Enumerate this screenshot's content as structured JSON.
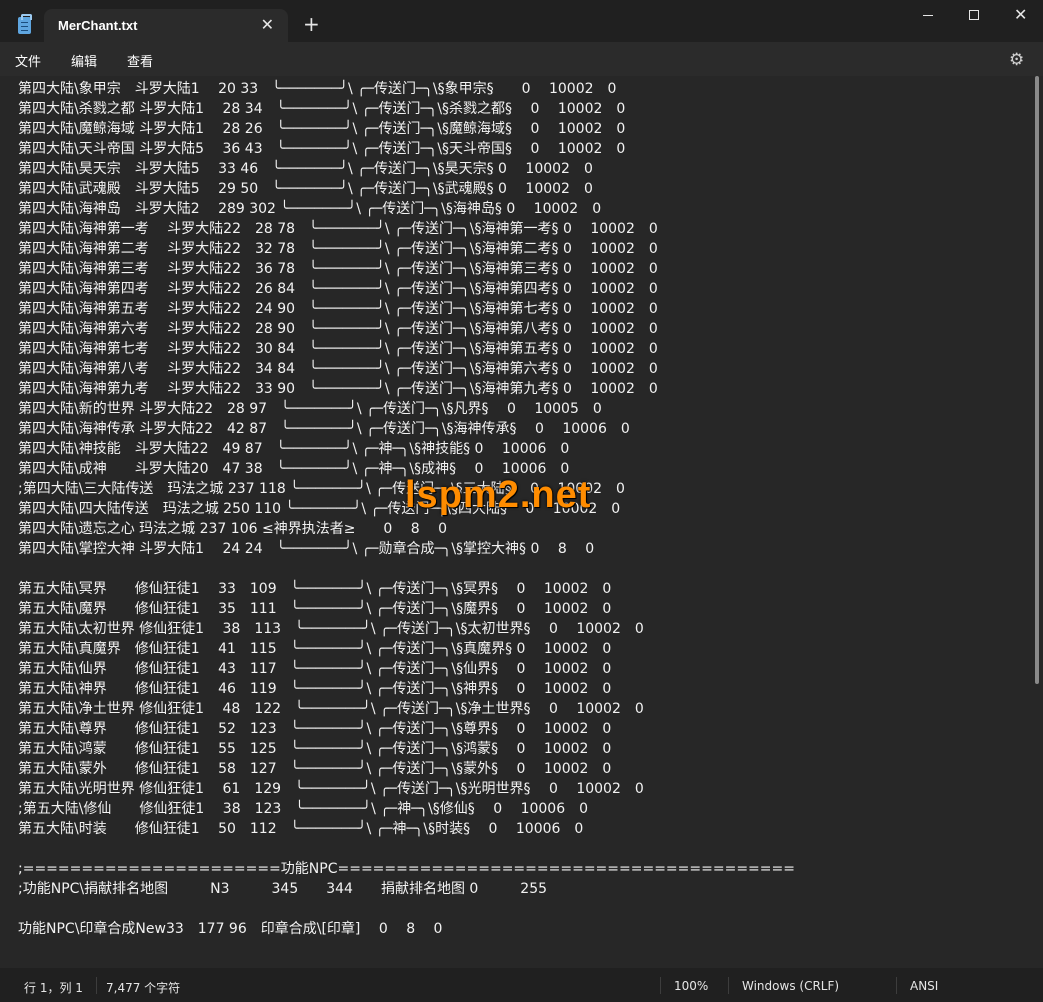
{
  "window": {
    "tab_title": "MerChant.txt",
    "tab_close": "✕",
    "new_tab": "+",
    "close_glyph": "✕"
  },
  "menu": {
    "file": "文件",
    "edit": "编辑",
    "view": "查看",
    "settings_icon": "settings-gear-icon"
  },
  "editor": {
    "lines": [
      "第四大陆\\象甲宗　斗罗大陆1　 20 33　╰───────╯\\ ╭─传送门─╮\\§象甲宗§　　0　 10002　0",
      "第四大陆\\杀戮之都 斗罗大陆1　 28 34　╰───────╯\\ ╭─传送门─╮\\§杀戮之都§　 0　 10002　0",
      "第四大陆\\魔鲸海域 斗罗大陆1　 28 26　╰───────╯\\ ╭─传送门─╮\\§魔鲸海域§　 0　 10002　0",
      "第四大陆\\天斗帝国 斗罗大陆5　 36 43　╰───────╯\\ ╭─传送门─╮\\§天斗帝国§　 0　 10002　0",
      "第四大陆\\昊天宗　斗罗大陆5　 33 46　╰───────╯\\ ╭─传送门─╮\\§昊天宗§ 0　 10002　0",
      "第四大陆\\武魂殿　斗罗大陆5　 29 50　╰───────╯\\ ╭─传送门─╮\\§武魂殿§ 0　 10002　0",
      "第四大陆\\海神岛　斗罗大陆2　 289 302 ╰───────╯\\ ╭─传送门─╮\\§海神岛§ 0　 10002　0",
      "第四大陆\\海神第一考　 斗罗大陆22　28 78　╰───────╯\\ ╭─传送门─╮\\§海神第一考§ 0　 10002　0",
      "第四大陆\\海神第二考　 斗罗大陆22　32 78　╰───────╯\\ ╭─传送门─╮\\§海神第二考§ 0　 10002　0",
      "第四大陆\\海神第三考　 斗罗大陆22　36 78　╰───────╯\\ ╭─传送门─╮\\§海神第三考§ 0　 10002　0",
      "第四大陆\\海神第四考　 斗罗大陆22　26 84　╰───────╯\\ ╭─传送门─╮\\§海神第四考§ 0　 10002　0",
      "第四大陆\\海神第五考　 斗罗大陆22　24 90　╰───────╯\\ ╭─传送门─╮\\§海神第七考§ 0　 10002　0",
      "第四大陆\\海神第六考　 斗罗大陆22　28 90　╰───────╯\\ ╭─传送门─╮\\§海神第八考§ 0　 10002　0",
      "第四大陆\\海神第七考　 斗罗大陆22　30 84　╰───────╯\\ ╭─传送门─╮\\§海神第五考§ 0　 10002　0",
      "第四大陆\\海神第八考　 斗罗大陆22　34 84　╰───────╯\\ ╭─传送门─╮\\§海神第六考§ 0　 10002　0",
      "第四大陆\\海神第九考　 斗罗大陆22　33 90　╰───────╯\\ ╭─传送门─╮\\§海神第九考§ 0　 10002　0",
      "第四大陆\\新的世界 斗罗大陆22　28 97　╰───────╯\\ ╭─传送门─╮\\§凡界§　 0　 10005　0",
      "第四大陆\\海神传承 斗罗大陆22　42 87　╰───────╯\\ ╭─传送门─╮\\§海神传承§　 0　 10006　0",
      "第四大陆\\神技能　斗罗大陆22　49 87　╰───────╯\\ ╭─神─╮\\§神技能§ 0　 10006　0",
      "第四大陆\\成神　　斗罗大陆20　47 38　╰───────╯\\ ╭─神─╮\\§成神§　 0　 10006　0",
      ";第四大陆\\三大陆传送　玛法之城 237 118 ╰───────╯\\ ╭─传送门─╮\\§三大陆§　 0　 10002　0",
      "第四大陆\\四大陆传送　玛法之城 250 110 ╰───────╯\\ ╭─传送门─╮\\§四大陆§　 0　 10002　0",
      "第四大陆\\遗忘之心 玛法之城 237 106 ≤神界执法者≥　　0　 8　 0",
      "第四大陆\\掌控大神 斗罗大陆1　 24 24　╰───────╯\\ ╭─勋章合成─╮\\§掌控大神§ 0　 8　 0",
      "",
      "第五大陆\\冥界　　修仙狂徒1　 33　109　╰───────╯\\ ╭─传送门─╮\\§冥界§　 0　 10002　0",
      "第五大陆\\魔界　　修仙狂徒1　 35　111　╰───────╯\\ ╭─传送门─╮\\§魔界§　 0　 10002　0",
      "第五大陆\\太初世界 修仙狂徒1　 38　113　╰───────╯\\ ╭─传送门─╮\\§太初世界§　 0　 10002　0",
      "第五大陆\\真魔界　修仙狂徒1　 41　115　╰───────╯\\ ╭─传送门─╮\\§真魔界§ 0　 10002　0",
      "第五大陆\\仙界　　修仙狂徒1　 43　117　╰───────╯\\ ╭─传送门─╮\\§仙界§　 0　 10002　0",
      "第五大陆\\神界　　修仙狂徒1　 46　119　╰───────╯\\ ╭─传送门─╮\\§神界§　 0　 10002　0",
      "第五大陆\\净土世界 修仙狂徒1　 48　122　╰───────╯\\ ╭─传送门─╮\\§净土世界§　 0　 10002　0",
      "第五大陆\\尊界　　修仙狂徒1　 52　123　╰───────╯\\ ╭─传送门─╮\\§尊界§　 0　 10002　0",
      "第五大陆\\鸿蒙　　修仙狂徒1　 55　125　╰───────╯\\ ╭─传送门─╮\\§鸿蒙§　 0　 10002　0",
      "第五大陆\\蒙外　　修仙狂徒1　 58　127　╰───────╯\\ ╭─传送门─╮\\§蒙外§　 0　 10002　0",
      "第五大陆\\光明世界 修仙狂徒1　 61　129　╰───────╯\\ ╭─传送门─╮\\§光明世界§　 0　 10002　0",
      ";第五大陆\\修仙　　修仙狂徒1　 38　123　╰───────╯\\ ╭─神─╮\\§修仙§　 0　 10006　0",
      "第五大陆\\时装　　修仙狂徒1　 50　112　╰───────╯\\ ╭─神─╮\\§时装§　 0　 10006　0",
      "",
      ";======================功能NPC=======================================",
      ";功能NPC\\捐献排名地图　　　N3　　　345　　344　　捐献排名地图 0　　　255",
      "",
      "功能NPC\\印章合成New33　177 96　印章合成\\[印章]　 0　 8　 0"
    ]
  },
  "watermark": "lspm2.net",
  "status": {
    "position": "行 1，列 1",
    "chars": "7,477 个字符",
    "zoom": "100%",
    "line_ending": "Windows (CRLF)",
    "encoding": "ANSI"
  }
}
